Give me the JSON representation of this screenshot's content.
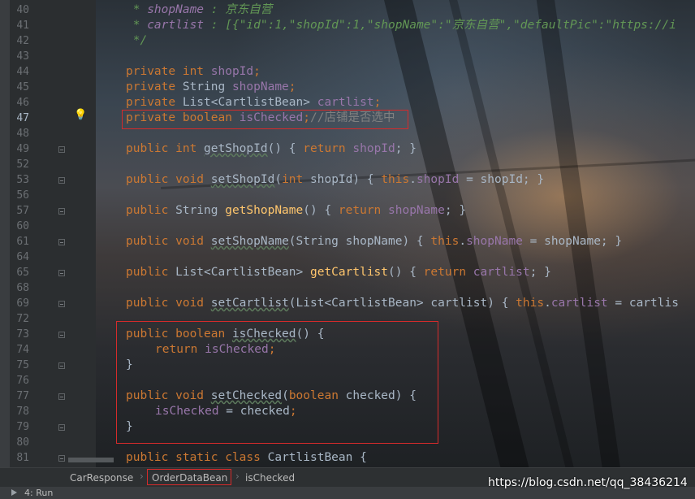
{
  "editor": {
    "lines": [
      {
        "n": "40",
        "segs": [
          {
            "t": " * ",
            "c": "doc"
          },
          {
            "t": "shopName",
            "c": "doctag"
          },
          {
            "t": " : 京东自营",
            "c": "doc"
          }
        ]
      },
      {
        "n": "41",
        "segs": [
          {
            "t": " * ",
            "c": "doc"
          },
          {
            "t": "cartlist",
            "c": "doctag"
          },
          {
            "t": " : [{\"id\":1,\"shopId\":1,\"shopName\":\"京东自营\",\"defaultPic\":\"",
            "c": "doc"
          },
          {
            "t": "https://i",
            "c": "doc"
          }
        ]
      },
      {
        "n": "42",
        "segs": [
          {
            "t": " */",
            "c": "doc"
          }
        ]
      },
      {
        "n": "43",
        "segs": []
      },
      {
        "n": "44",
        "segs": [
          {
            "t": "private int ",
            "c": "kw"
          },
          {
            "t": "shopId",
            "c": "field"
          },
          {
            "t": ";",
            "c": "kw"
          }
        ]
      },
      {
        "n": "45",
        "segs": [
          {
            "t": "private ",
            "c": "kw"
          },
          {
            "t": "String ",
            "c": ""
          },
          {
            "t": "shopName",
            "c": "field"
          },
          {
            "t": ";",
            "c": "kw"
          }
        ]
      },
      {
        "n": "46",
        "segs": [
          {
            "t": "private ",
            "c": "kw"
          },
          {
            "t": "List<CartlistBean> ",
            "c": ""
          },
          {
            "t": "cartlist",
            "c": "field"
          },
          {
            "t": ";",
            "c": "kw"
          }
        ]
      },
      {
        "n": "47",
        "segs": [
          {
            "t": "private boolean ",
            "c": "kw"
          },
          {
            "t": "isChecked",
            "c": "field"
          },
          {
            "t": ";",
            "c": "kw"
          },
          {
            "t": "//店铺是否选中",
            "c": "cmt"
          }
        ]
      },
      {
        "n": "48",
        "segs": []
      },
      {
        "n": "49",
        "segs": [
          {
            "t": "public int ",
            "c": "kw"
          },
          {
            "t": "getShopId",
            "c": "ul"
          },
          {
            "t": "() { ",
            "c": ""
          },
          {
            "t": "return ",
            "c": "kw"
          },
          {
            "t": "shopId",
            "c": "field"
          },
          {
            "t": "; }",
            "c": ""
          }
        ]
      },
      {
        "n": "52",
        "segs": []
      },
      {
        "n": "53",
        "segs": [
          {
            "t": "public void ",
            "c": "kw"
          },
          {
            "t": "setShopId",
            "c": "ul"
          },
          {
            "t": "(",
            "c": ""
          },
          {
            "t": "int ",
            "c": "kw"
          },
          {
            "t": "shopId) { ",
            "c": ""
          },
          {
            "t": "this",
            "c": "kw"
          },
          {
            "t": ".",
            "c": ""
          },
          {
            "t": "shopId",
            "c": "field"
          },
          {
            "t": " = shopId; }",
            "c": ""
          }
        ]
      },
      {
        "n": "56",
        "segs": []
      },
      {
        "n": "57",
        "segs": [
          {
            "t": "public ",
            "c": "kw"
          },
          {
            "t": "String ",
            "c": ""
          },
          {
            "t": "getShopName",
            "c": "mth"
          },
          {
            "t": "() { ",
            "c": ""
          },
          {
            "t": "return ",
            "c": "kw"
          },
          {
            "t": "shopName",
            "c": "field"
          },
          {
            "t": "; }",
            "c": ""
          }
        ]
      },
      {
        "n": "60",
        "segs": []
      },
      {
        "n": "61",
        "segs": [
          {
            "t": "public void ",
            "c": "kw"
          },
          {
            "t": "setShopName",
            "c": "ul"
          },
          {
            "t": "(String shopName) { ",
            "c": ""
          },
          {
            "t": "this",
            "c": "kw"
          },
          {
            "t": ".",
            "c": ""
          },
          {
            "t": "shopName",
            "c": "field"
          },
          {
            "t": " = shopName; }",
            "c": ""
          }
        ]
      },
      {
        "n": "64",
        "segs": []
      },
      {
        "n": "65",
        "segs": [
          {
            "t": "public ",
            "c": "kw"
          },
          {
            "t": "List<CartlistBean> ",
            "c": ""
          },
          {
            "t": "getCartlist",
            "c": "mth"
          },
          {
            "t": "() { ",
            "c": ""
          },
          {
            "t": "return ",
            "c": "kw"
          },
          {
            "t": "cartlist",
            "c": "field"
          },
          {
            "t": "; }",
            "c": ""
          }
        ]
      },
      {
        "n": "68",
        "segs": []
      },
      {
        "n": "69",
        "segs": [
          {
            "t": "public void ",
            "c": "kw"
          },
          {
            "t": "setCartlist",
            "c": "ul"
          },
          {
            "t": "(List<CartlistBean> cartlist) { ",
            "c": ""
          },
          {
            "t": "this",
            "c": "kw"
          },
          {
            "t": ".",
            "c": ""
          },
          {
            "t": "cartlist",
            "c": "field"
          },
          {
            "t": " = cartlis",
            "c": ""
          }
        ]
      },
      {
        "n": "72",
        "segs": []
      },
      {
        "n": "73",
        "segs": [
          {
            "t": "public boolean ",
            "c": "kw"
          },
          {
            "t": "isChecked",
            "c": "ul"
          },
          {
            "t": "() {",
            "c": ""
          }
        ]
      },
      {
        "n": "74",
        "indent": true,
        "segs": [
          {
            "t": "return ",
            "c": "kw"
          },
          {
            "t": "isChecked",
            "c": "field"
          },
          {
            "t": ";",
            "c": "kw"
          }
        ]
      },
      {
        "n": "75",
        "segs": [
          {
            "t": "}",
            "c": ""
          }
        ]
      },
      {
        "n": "76",
        "segs": []
      },
      {
        "n": "77",
        "segs": [
          {
            "t": "public void ",
            "c": "kw"
          },
          {
            "t": "setChecked",
            "c": "ul"
          },
          {
            "t": "(",
            "c": ""
          },
          {
            "t": "boolean ",
            "c": "kw"
          },
          {
            "t": "checked) {",
            "c": ""
          }
        ]
      },
      {
        "n": "78",
        "indent": true,
        "segs": [
          {
            "t": "isChecked",
            "c": "field"
          },
          {
            "t": " = checked",
            "c": ""
          },
          {
            "t": ";",
            "c": "kw"
          }
        ]
      },
      {
        "n": "79",
        "segs": [
          {
            "t": "}",
            "c": ""
          }
        ]
      },
      {
        "n": "80",
        "segs": []
      },
      {
        "n": "81",
        "segs": [
          {
            "t": "public static class ",
            "c": "kw"
          },
          {
            "t": "CartlistBean {",
            "c": ""
          }
        ]
      }
    ],
    "active_line": "47"
  },
  "breadcrumb": {
    "items": [
      "CarResponse",
      "OrderDataBean",
      "isChecked"
    ]
  },
  "statusbar": {
    "run_label": "4: Run"
  },
  "watermark": "https://blog.csdn.net/qq_38436214",
  "colors": {
    "keyword": "#cc7832",
    "field": "#9876aa",
    "method": "#ffc66d",
    "doc": "#629755",
    "comment": "#808080",
    "highlight_box": "#d52b2b"
  }
}
